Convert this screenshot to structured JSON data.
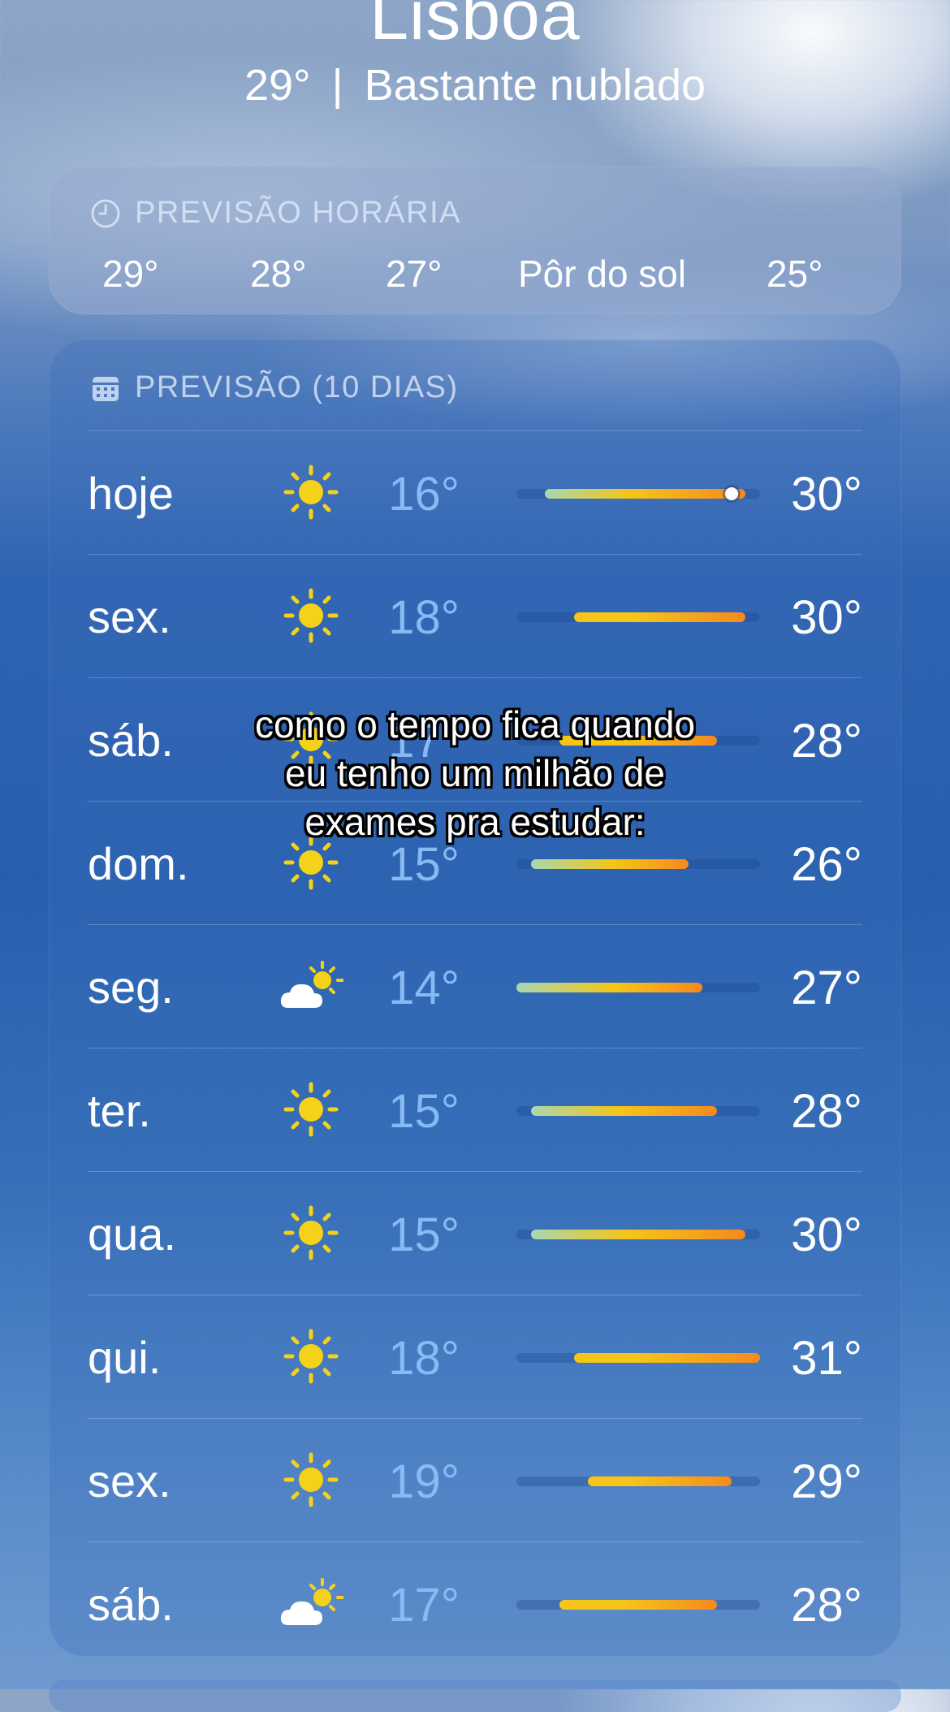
{
  "location": {
    "city": "Lisboa",
    "temperature": "29°",
    "separator": "|",
    "condition": "Bastante nublado"
  },
  "hourly": {
    "title": "PREVISÃO HORÁRIA",
    "icon": "clock-icon",
    "items": [
      "29°",
      "28°",
      "27°",
      "Pôr do sol",
      "25°"
    ]
  },
  "daily": {
    "title": "PREVISÃO (10 DIAS)",
    "icon": "calendar-icon",
    "range_min": 14,
    "range_max": 31,
    "current_temp": 29,
    "rows": [
      {
        "day": "hoje",
        "icon": "sun-icon",
        "low": "16°",
        "high": "30°",
        "lo": 16,
        "hi": 30
      },
      {
        "day": "sex.",
        "icon": "sun-icon",
        "low": "18°",
        "high": "30°",
        "lo": 18,
        "hi": 30
      },
      {
        "day": "sáb.",
        "icon": "sun-icon",
        "low": "17°",
        "high": "28°",
        "lo": 17,
        "hi": 28
      },
      {
        "day": "dom.",
        "icon": "sun-icon",
        "low": "15°",
        "high": "26°",
        "lo": 15,
        "hi": 26
      },
      {
        "day": "seg.",
        "icon": "partly-cloudy-icon",
        "low": "14°",
        "high": "27°",
        "lo": 14,
        "hi": 27
      },
      {
        "day": "ter.",
        "icon": "sun-icon",
        "low": "15°",
        "high": "28°",
        "lo": 15,
        "hi": 28
      },
      {
        "day": "qua.",
        "icon": "sun-icon",
        "low": "15°",
        "high": "30°",
        "lo": 15,
        "hi": 30
      },
      {
        "day": "qui.",
        "icon": "sun-icon",
        "low": "18°",
        "high": "31°",
        "lo": 18,
        "hi": 31
      },
      {
        "day": "sex.",
        "icon": "sun-icon",
        "low": "19°",
        "high": "29°",
        "lo": 19,
        "hi": 29
      },
      {
        "day": "sáb.",
        "icon": "partly-cloudy-icon",
        "low": "17°",
        "high": "28°",
        "lo": 17,
        "hi": 28
      }
    ]
  },
  "overlay_caption": "como o tempo fica quando eu tenho um milhão de exames pra estudar:",
  "colors": {
    "low_temp": "#8cbef5",
    "bar_cool": "#a8d8b0",
    "bar_mid": "#f5c518",
    "bar_warm": "#f58a1e"
  }
}
